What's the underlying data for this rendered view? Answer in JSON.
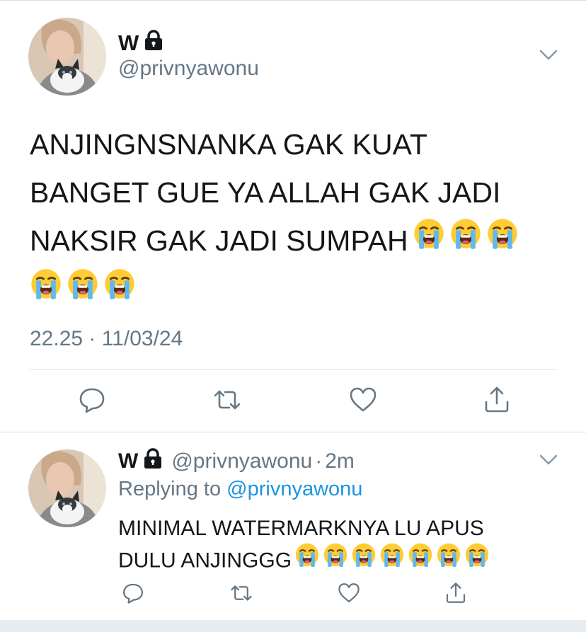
{
  "main_tweet": {
    "author_name": "W",
    "handle": "@privnyawonu",
    "text_lines": [
      "ANJINGNSNANKA GAK KUAT",
      "BANGET GUE YA ALLAH GAK JADI",
      "NAKSIR GAK JADI SUMPAH"
    ],
    "emoji_icon": "loudly-crying-face-icon",
    "emoji_counts": {
      "line3": 3,
      "line4": 3
    },
    "timestamp": "22.25 · 11/03/24"
  },
  "reply_tweet": {
    "author_name": "W",
    "handle": "@privnyawonu",
    "time_separator": "·",
    "age": "2m",
    "replying_prefix": "Replying to",
    "replying_to": "@privnyawonu",
    "text_lines": [
      "MINIMAL WATERMARKNYA LU APUS",
      "DULU ANJINGGG"
    ],
    "emoji_count": 7
  },
  "icons": {
    "protected": "lock-icon",
    "menu": "chevron-down-icon",
    "actions": [
      "reply-icon",
      "retweet-icon",
      "like-icon",
      "share-icon"
    ]
  },
  "colors": {
    "text": "#14171a",
    "muted": "#657786",
    "link": "#1b95e0",
    "divider": "#e1e8ed",
    "icon": "#657786"
  }
}
